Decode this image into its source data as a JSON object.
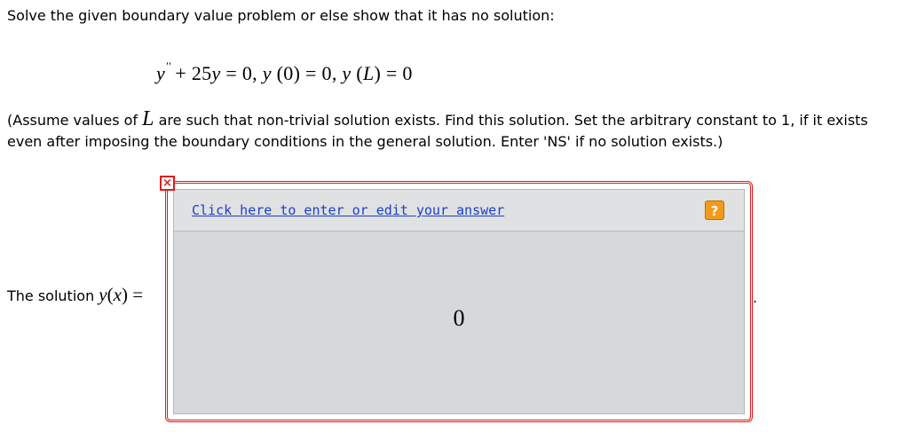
{
  "prompt": "Solve the given boundary value problem or else show that it has no solution:",
  "equation": {
    "y1": "y",
    "prime": "′′",
    "plus": "+ 25",
    "y2": "y",
    "eq0": " = 0,  ",
    "y3": "y",
    "arg0": " (0) = 0,  ",
    "y4": "y",
    "arg_open": " (",
    "L": "L",
    "arg_close": ") = 0"
  },
  "instructions": {
    "part1": "(Assume values of ",
    "L": "L",
    "part2": " are such that non-trivial solution exists. Find this solution. Set the arbitrary constant to 1, if it exists even after imposing the boundary conditions in the general solution. Enter 'NS' if no solution exists.)"
  },
  "solution": {
    "label": "The solution ",
    "y": "y",
    "paren_open": "(",
    "x": "x",
    "paren_close": ")",
    "equals": " ="
  },
  "answer_widget": {
    "edit_link": "Click here to enter or edit your answer",
    "help_label": "?",
    "close_label": "×",
    "value": "0"
  },
  "trailing_dot": "."
}
